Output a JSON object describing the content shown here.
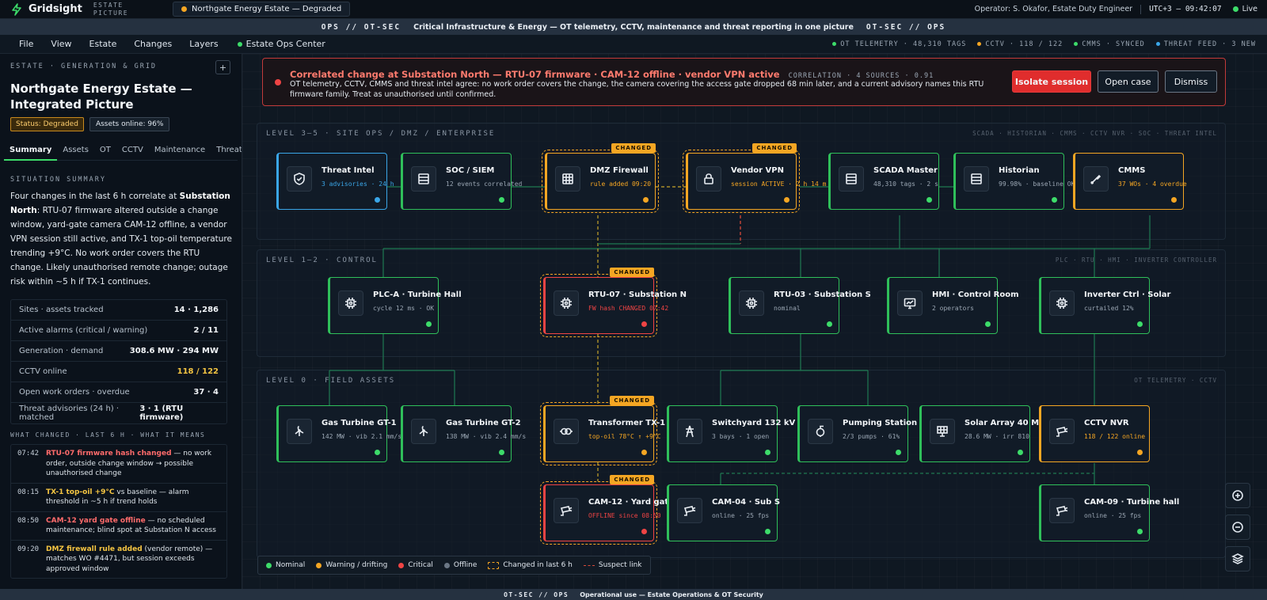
{
  "app": {
    "name": "Gridsight",
    "subtitle_line1": "ESTATE",
    "subtitle_line2": "PICTURE",
    "tab": "Northgate Energy Estate — Degraded"
  },
  "topbar": {
    "operator": "Operator: S. Okafor, Estate Duty Engineer",
    "clock": "UTC+3 — 09:42:07",
    "live": "Live"
  },
  "classbar": {
    "left": "OPS // OT-SEC",
    "text": "Critical Infrastructure & Energy — OT telemetry, CCTV, maintenance and threat reporting in one picture",
    "right": "OT-SEC // OPS"
  },
  "menu": {
    "items": [
      "File",
      "View",
      "Estate",
      "Changes",
      "Layers"
    ],
    "ops_center": "Estate Ops Center",
    "status": [
      {
        "label": "OT TELEMETRY · 48,310 TAGS",
        "color": "#3ddc6a"
      },
      {
        "label": "CCTV · 118 / 122",
        "color": "#f5a623"
      },
      {
        "label": "CMMS · SYNCED",
        "color": "#3ddc6a"
      },
      {
        "label": "THREAT FEED · 3 NEW",
        "color": "#3aa6e8"
      }
    ]
  },
  "sidebar": {
    "eyebrow": "ESTATE · GENERATION & GRID",
    "add_button": "+",
    "title": "Northgate Energy Estate — Integrated Picture",
    "status_badge": "Status: Degraded",
    "assets_badge": "Assets online: 96%",
    "tabs": [
      "Summary",
      "Assets",
      "OT",
      "CCTV",
      "Maintenance",
      "Threats"
    ],
    "situation_heading": "SITUATION SUMMARY",
    "summary_pre": "Four changes in the last 6 h correlate at ",
    "summary_bold": "Substation North",
    "summary_post": ": RTU-07 firmware altered outside a change window, yard-gate camera CAM-12 offline, a vendor VPN session still active, and TX-1 top-oil temperature trending +9°C. No work order covers the RTU change. Likely unauthorised remote change; outage risk within ~5 h if TX-1 continues.",
    "stats": [
      {
        "label": "Sites · assets tracked",
        "value": "14 · 1,286",
        "color": "#f2f5f8"
      },
      {
        "label": "Active alarms (critical / warning)",
        "value": "2 / 11",
        "color": "#f2f5f8"
      },
      {
        "label": "Generation · demand",
        "value": "308.6 MW · 294 MW",
        "color": "#f2f5f8"
      },
      {
        "label": "CCTV online",
        "value": "118 / 122",
        "color": "#f5c542"
      },
      {
        "label": "Open work orders · overdue",
        "value": "37 · 4",
        "color": "#f2f5f8"
      },
      {
        "label": "Threat advisories (24 h) · matched",
        "value": "3 · 1 (RTU firmware)",
        "color": "#f2f5f8"
      }
    ],
    "changes_heading": "WHAT CHANGED · LAST 6 H · WHAT IT MEANS",
    "changes": [
      {
        "time": "07:42",
        "head": "RTU-07 firmware hash changed",
        "color": "#ff6b6b",
        "text": " — no work order, outside change window → possible unauthorised change"
      },
      {
        "time": "08:15",
        "head": "TX-1 top-oil +9°C",
        "color": "#f5c542",
        "text": " vs baseline — alarm threshold in ~5 h if trend holds"
      },
      {
        "time": "08:50",
        "head": "CAM-12 yard gate offline",
        "color": "#ff6b6b",
        "text": " — no scheduled maintenance; blind spot at Substation N access"
      },
      {
        "time": "09:20",
        "head": "DMZ firewall rule added",
        "color": "#f5c542",
        "text": " (vendor remote) — matches WO #4471, but session exceeds approved window"
      }
    ]
  },
  "alert": {
    "title": "Correlated change at Substation North — RTU-07 firmware · CAM-12 offline · vendor VPN active",
    "meta": "CORRELATION · 4 SOURCES · 0.91",
    "body": "OT telemetry, CCTV, CMMS and threat intel agree: no work order covers the change, the camera covering the access gate dropped 68 min later, and a current advisory names this RTU firmware family. Treat as unauthorised until confirmed.",
    "isolate": "Isolate session",
    "open_case": "Open case",
    "dismiss": "Dismiss"
  },
  "levels": {
    "l35": {
      "title": "LEVEL 3–5 · SITE OPS / DMZ / ENTERPRISE",
      "right": "SCADA · HISTORIAN · CMMS · CCTV NVR · SOC · THREAT INTEL"
    },
    "l12": {
      "title": "LEVEL 1–2 · CONTROL",
      "right": "PLC · RTU · HMI · INVERTER CONTROLLER"
    },
    "l0": {
      "title": "LEVEL 0 · FIELD ASSETS",
      "right": "OT TELEMETRY · CCTV"
    }
  },
  "nodes": {
    "threat_intel": {
      "name": "Threat Intel",
      "sub": "3 advisories · 24 h",
      "icon": "shield-icon"
    },
    "soc": {
      "name": "SOC / SIEM",
      "sub": "12 events correlated",
      "icon": "server-icon"
    },
    "dmz": {
      "name": "DMZ Firewall",
      "sub": "rule added 09:20",
      "icon": "firewall-icon",
      "badge": "CHANGED"
    },
    "vpn": {
      "name": "Vendor VPN",
      "sub": "session ACTIVE · 2 h 14 m",
      "icon": "lock-icon",
      "badge": "CHANGED"
    },
    "scada": {
      "name": "SCADA Master",
      "sub": "48,310 tags · 2 s",
      "icon": "server-icon"
    },
    "historian": {
      "name": "Historian",
      "sub": "99.98% · baseline OK",
      "icon": "server-icon"
    },
    "cmms": {
      "name": "CMMS",
      "sub": "37 WOs · 4 overdue",
      "icon": "wrench-icon"
    },
    "plca": {
      "name": "PLC-A · Turbine Hall",
      "sub": "cycle 12 ms · OK",
      "icon": "chip-icon"
    },
    "rtu07": {
      "name": "RTU-07 · Substation N",
      "sub": "FW hash CHANGED 07:42",
      "icon": "chip-icon",
      "badge": "CHANGED"
    },
    "rtu03": {
      "name": "RTU-03 · Substation S",
      "sub": "nominal",
      "icon": "chip-icon"
    },
    "hmi": {
      "name": "HMI · Control Room",
      "sub": "2 operators",
      "icon": "monitor-icon"
    },
    "inverter": {
      "name": "Inverter Ctrl · Solar",
      "sub": "curtailed 12%",
      "icon": "chip-icon"
    },
    "gt1": {
      "name": "Gas Turbine GT-1",
      "sub": "142 MW · vib 2.1 mm/s",
      "icon": "turbine-icon"
    },
    "gt2": {
      "name": "Gas Turbine GT-2",
      "sub": "138 MW · vib 2.4 mm/s",
      "icon": "turbine-icon"
    },
    "tx1": {
      "name": "Transformer TX-1",
      "sub": "top-oil 78°C ↑ +9°C",
      "icon": "transformer-icon",
      "badge": "CHANGED"
    },
    "switchyard": {
      "name": "Switchyard 132 kV",
      "sub": "3 bays · 1 open",
      "icon": "pylon-icon"
    },
    "pumping": {
      "name": "Pumping Station",
      "sub": "2/3 pumps · 61%",
      "icon": "pump-icon"
    },
    "solar": {
      "name": "Solar Array 40 MW",
      "sub": "28.6 MW · irr 810",
      "icon": "solar-icon"
    },
    "nvr": {
      "name": "CCTV NVR",
      "sub": "118 / 122 online",
      "icon": "camera-icon"
    },
    "cam12": {
      "name": "CAM-12 · Yard gate",
      "sub": "OFFLINE since 08:50",
      "icon": "camera-icon",
      "badge": "CHANGED"
    },
    "cam04": {
      "name": "CAM-04 · Sub S",
      "sub": "online · 25 fps",
      "icon": "camera-icon"
    },
    "cam09": {
      "name": "CAM-09 · Turbine hall",
      "sub": "online · 25 fps",
      "icon": "camera-icon"
    }
  },
  "legend": {
    "nominal": "Nominal",
    "warning": "Warning / drifting",
    "critical": "Critical",
    "offline": "Offline",
    "changed": "Changed in last 6 h",
    "suspect": "Suspect link"
  },
  "colors": {
    "nominal": "#3ddc6a",
    "warning": "#f5a623",
    "critical": "#ef4444",
    "info": "#3aa6e8",
    "offline": "#6b7785"
  },
  "footer": {
    "cls": "OT-SEC // OPS",
    "text": "Operational use — Estate Operations & OT Security"
  }
}
